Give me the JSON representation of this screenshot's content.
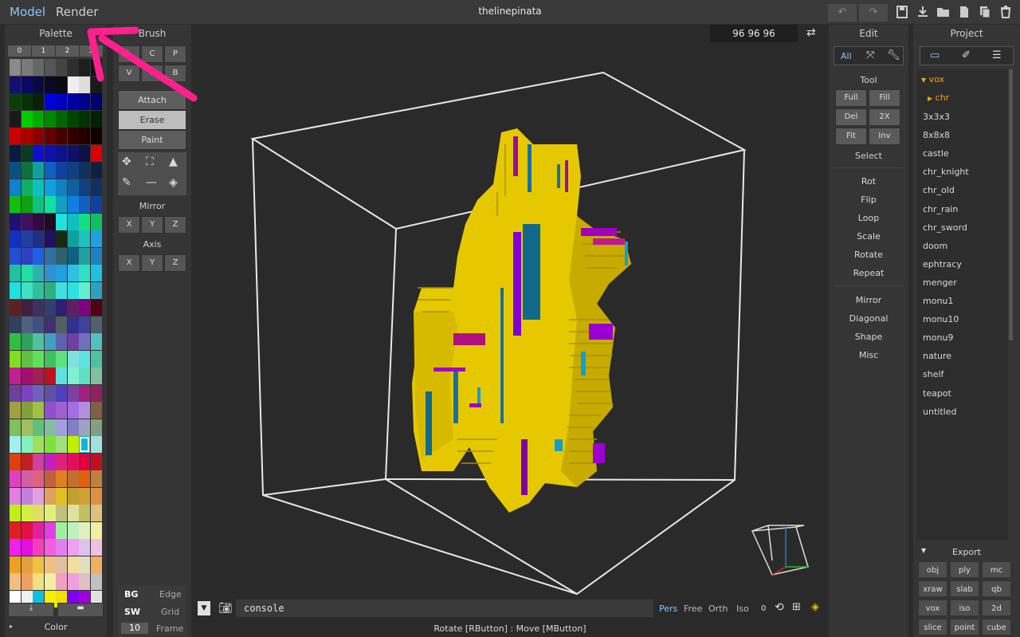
{
  "topbar": {
    "model_tab": "Model",
    "render_tab": "Render",
    "title": "thelinepinata",
    "undo_icon": "undo-icon",
    "redo_icon": "redo-icon"
  },
  "palette": {
    "header": "Palette",
    "tabs": [
      "0",
      "1",
      "2",
      "3"
    ],
    "footer_label": "Color",
    "colors": [
      [
        "#8a8a8a",
        "#7a7a7a",
        "#666",
        "#555",
        "#444",
        "#2e2e2e",
        "#1e1e1e",
        "#121212"
      ],
      [
        "#101070",
        "#0a0a60",
        "#0a0a40",
        "#0a0a25",
        "#0a0a10",
        "#eeeeee",
        "#dddddd",
        "#1a1a1a"
      ],
      [
        "#0a3d0a",
        "#0a300a",
        "#0a200a",
        "#0000dd",
        "#0000c0",
        "#0000a0",
        "#00008a",
        "#000070"
      ],
      [
        "#1a1a1a",
        "#00cc00",
        "#00aa00",
        "#008800",
        "#006600",
        "#004400",
        "#003300",
        "#002200"
      ],
      [
        "#cc0000",
        "#aa0000",
        "#880000",
        "#660000",
        "#440000",
        "#330000",
        "#220000",
        "#110000"
      ],
      [
        "#0a1a40",
        "#0a3a20",
        "#1010cc",
        "#1010aa",
        "#101088",
        "#101066",
        "#101044",
        "#dd0000"
      ],
      [
        "#0a5080",
        "#107040",
        "#10a0a0",
        "#1060c0",
        "#1040a0",
        "#104080",
        "#103060",
        "#102040"
      ],
      [
        "#1080d0",
        "#10b060",
        "#10c0c0",
        "#10a0e0",
        "#1080c0",
        "#1060a0",
        "#104080",
        "#103060"
      ],
      [
        "#10c010",
        "#10a010",
        "#10c080",
        "#10e0a0",
        "#10a0c0",
        "#1080e0",
        "#1060c0",
        "#1040a0"
      ],
      [
        "#201070",
        "#401060",
        "#300a40",
        "#200a20",
        "#20e0e0",
        "#10c0c0",
        "#10e080",
        "#10c060"
      ],
      [
        "#1030c0",
        "#2040a0",
        "#203080",
        "#201060",
        "#1a2a10",
        "#10a0a0",
        "#20c0c0",
        "#20a0e0"
      ],
      [
        "#2050d0",
        "#3040c0",
        "#2060e0",
        "#3070a0",
        "#306070",
        "#106080",
        "#20a0a0",
        "#2080c0"
      ],
      [
        "#20c0a0",
        "#20e0a0",
        "#30b0b0",
        "#3090d0",
        "#20a0e0",
        "#30c0e0",
        "#30e0c0",
        "#20c0e0"
      ],
      [
        "#20e0e0",
        "#40e0c0",
        "#30c0a0",
        "#30b080",
        "#40e0e0",
        "#30e0e0",
        "#60f0d0",
        "#30a0c0"
      ],
      [
        "#602020",
        "#402040",
        "#403060",
        "#304070",
        "#302070",
        "#602060",
        "#800080",
        "#500010"
      ],
      [
        "#304060",
        "#506080",
        "#405080",
        "#403070",
        "#506060",
        "#303090",
        "#4040a0",
        "#506070"
      ],
      [
        "#30c040",
        "#30a060",
        "#50c0a0",
        "#40a0c0",
        "#6060b0",
        "#7040a0",
        "#7070c0",
        "#50c0c0"
      ],
      [
        "#80e020",
        "#60c040",
        "#60e060",
        "#40c060",
        "#60e080",
        "#80e0e0",
        "#60e0e0",
        "#50c0a0"
      ],
      [
        "#c02090",
        "#a01070",
        "#a02050",
        "#c01020",
        "#60e0e0",
        "#80f0d0",
        "#60e0c0",
        "#80c0a0"
      ],
      [
        "#7040a0",
        "#8040c0",
        "#7060c0",
        "#6050a0",
        "#5040c0",
        "#8040a0",
        "#a02080",
        "#902060"
      ],
      [
        "#a0a040",
        "#80a040",
        "#a0c040",
        "#9050d0",
        "#a060d0",
        "#a070e0",
        "#b090e0",
        "#806040"
      ],
      [
        "#80c060",
        "#a0c060",
        "#60c080",
        "#80c0a0",
        "#a0a0e0",
        "#8080c0",
        "#a0a0c0",
        "#80a080"
      ],
      [
        "#a0f0f0",
        "#80f0c0",
        "#a0e060",
        "#80e040",
        "#a0e080",
        "#c0f000",
        "#00c0d0",
        "#a0e0e0"
      ],
      [
        "#e04010",
        "#c02020",
        "#d040a0",
        "#c020c0",
        "#e02080",
        "#e01060",
        "#e00040",
        "#c01020"
      ],
      [
        "#e040c0",
        "#d060a0",
        "#e06080",
        "#c06040",
        "#e08020",
        "#c07030",
        "#e06010",
        "#c08040"
      ],
      [
        "#e080e0",
        "#c080e0",
        "#e0a0e0",
        "#e0a060",
        "#e0c020",
        "#c0a030",
        "#d0a030",
        "#e09040"
      ],
      [
        "#c0f010",
        "#d0f040",
        "#e0e060",
        "#e0f080",
        "#c0c080",
        "#e0e0a0",
        "#c0c060",
        "#e0c080"
      ],
      [
        "#e02020",
        "#e01040",
        "#e020a0",
        "#e040e0",
        "#a0f0a0",
        "#c0f0c0",
        "#e0f0c0",
        "#f0f0a0"
      ],
      [
        "#f020f0",
        "#e010e0",
        "#f040c0",
        "#f060e0",
        "#e080f0",
        "#f0a0f0",
        "#e0c0f0",
        "#f0c0e0"
      ],
      [
        "#f0a020",
        "#e0a040",
        "#f0c040",
        "#f0c080",
        "#e0c0a0",
        "#f0e0a0",
        "#e0e0c0",
        "#f0b060"
      ],
      [
        "#f0c080",
        "#f0a060",
        "#f0e080",
        "#f0f0a0",
        "#f0a0c0",
        "#f0a0e0",
        "#e0c0c0",
        "#c0c0c0"
      ],
      [
        "#ffffff",
        "#f0f0f0",
        "#10c0e0",
        "#f0f000",
        "#f0e000",
        "#8000f0",
        "#a000e0",
        "#e0e0e0"
      ]
    ],
    "selected_color": "#00b8d8"
  },
  "brush": {
    "header": "Brush",
    "row1": [
      "L",
      "C",
      "P"
    ],
    "row2": [
      "V",
      "F",
      "B"
    ],
    "modes": [
      "Attach",
      "Erase",
      "Paint"
    ],
    "mirror_label": "Mirror",
    "mirror_axes": [
      "X",
      "Y",
      "Z"
    ],
    "axis_label": "Axis",
    "axis_axes": [
      "X",
      "Y",
      "Z"
    ],
    "bg_label": "BG",
    "edge_label": "Edge",
    "sw_label": "SW",
    "grid_label": "Grid",
    "frame_value": "10",
    "frame_label": "Frame"
  },
  "viewport": {
    "dims": "96 96 96",
    "console_placeholder": "console",
    "proj_modes": [
      "Pers",
      "Free",
      "Orth",
      "Iso"
    ],
    "zero": "0",
    "status": "Rotate [RButton] : Move [MButton]"
  },
  "edit": {
    "header": "Edit",
    "all": "All",
    "tool_label": "Tool",
    "tool_buttons": [
      "Full",
      "Fill",
      "Del",
      "2X",
      "Fit",
      "Inv"
    ],
    "select_label": "Select",
    "group1": [
      "Rot",
      "Flip",
      "Loop",
      "Scale",
      "Rotate",
      "Repeat"
    ],
    "group2": [
      "Mirror",
      "Diagonal",
      "Shape",
      "Misc"
    ]
  },
  "project": {
    "header": "Project",
    "root": "vox",
    "child": "chr",
    "items": [
      "3x3x3",
      "8x8x8",
      "castle",
      "chr_knight",
      "chr_old",
      "chr_rain",
      "chr_sword",
      "doom",
      "ephtracy",
      "menger",
      "monu1",
      "monu10",
      "monu9",
      "nature",
      "shelf",
      "teapot",
      "untitled"
    ],
    "export_label": "Export",
    "export_buttons": [
      "obj",
      "ply",
      "mc",
      "xraw",
      "slab",
      "qb",
      "vox",
      "iso",
      "2d",
      "slice",
      "point",
      "cube"
    ]
  }
}
